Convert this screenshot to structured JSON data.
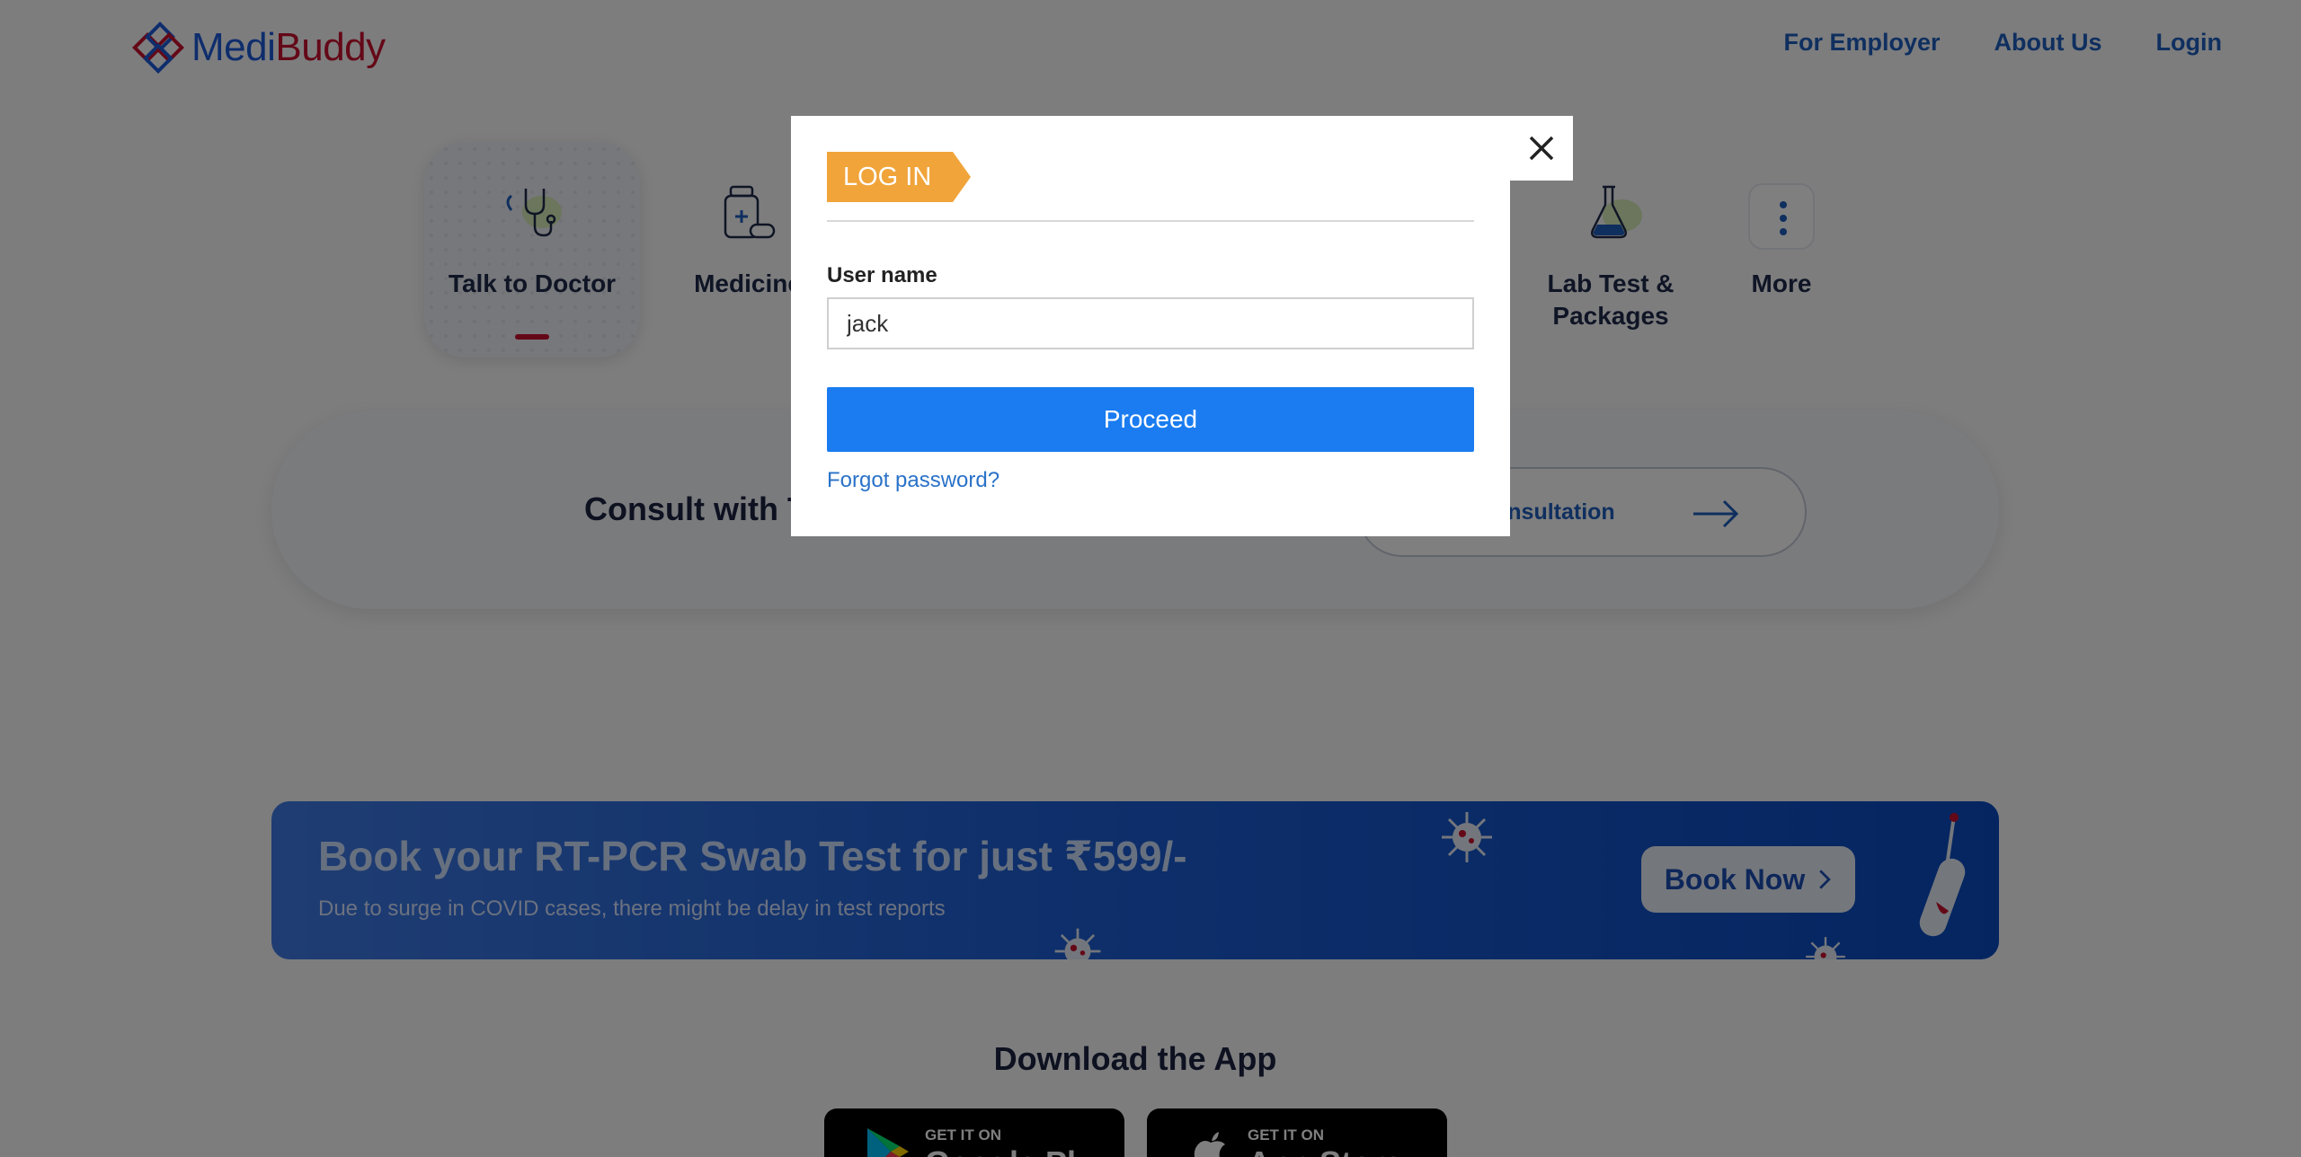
{
  "brand": {
    "medi": "Medi",
    "buddy": "Buddy"
  },
  "nav": {
    "employer": "For Employer",
    "about": "About Us",
    "login": "Login"
  },
  "tiles": {
    "doctor": "Talk to Doctor",
    "medicine": "Medicine",
    "lab": "Lab Test & Packages",
    "more": "More"
  },
  "consult": {
    "title": "Consult with T",
    "button": "onsultation"
  },
  "covid": {
    "title": "Book your RT-PCR Swab Test for just ₹599/-",
    "subtitle": "Due to surge in COVID cases, there might be delay in test reports",
    "button": "Book Now"
  },
  "download": {
    "title": "Download the App",
    "google_top": "GET IT ON",
    "google_name": "Google Pl",
    "apple_top": "GET IT ON",
    "apple_name": "App Store"
  },
  "modal": {
    "badge": "LOG IN",
    "username_label": "User name",
    "username_value": "jack",
    "proceed": "Proceed",
    "forgot": "Forgot password?"
  },
  "colors": {
    "primary_blue": "#1a7cf0",
    "badge_orange": "#f0a43a",
    "brand_red": "#c8102e",
    "brand_blue": "#1c5bd8"
  }
}
